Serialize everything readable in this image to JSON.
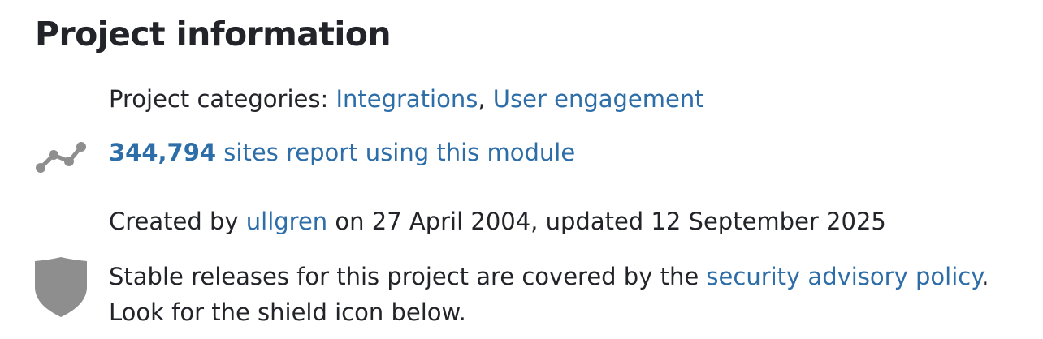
{
  "section": {
    "title": "Project information"
  },
  "categories": {
    "prefix": "Project categories: ",
    "items": [
      "Integrations",
      "User engagement"
    ],
    "separator": ", "
  },
  "usage": {
    "count": "344,794",
    "text": " sites report using this module",
    "icon": "usage-stats-icon",
    "icon_color": "#8e8e8e"
  },
  "created": {
    "prefix": "Created by ",
    "author": "ullgren",
    "suffix": " on 27 April 2004, updated 12 September 2025"
  },
  "security": {
    "line1_prefix": "Stable releases for this project are covered by the ",
    "policy_link": "security advisory policy",
    "line1_suffix": ".",
    "line2": "Look for the shield icon below.",
    "icon": "shield-icon",
    "icon_color": "#8e8e8e"
  },
  "colors": {
    "link": "#2d6da8",
    "text": "#232429"
  }
}
